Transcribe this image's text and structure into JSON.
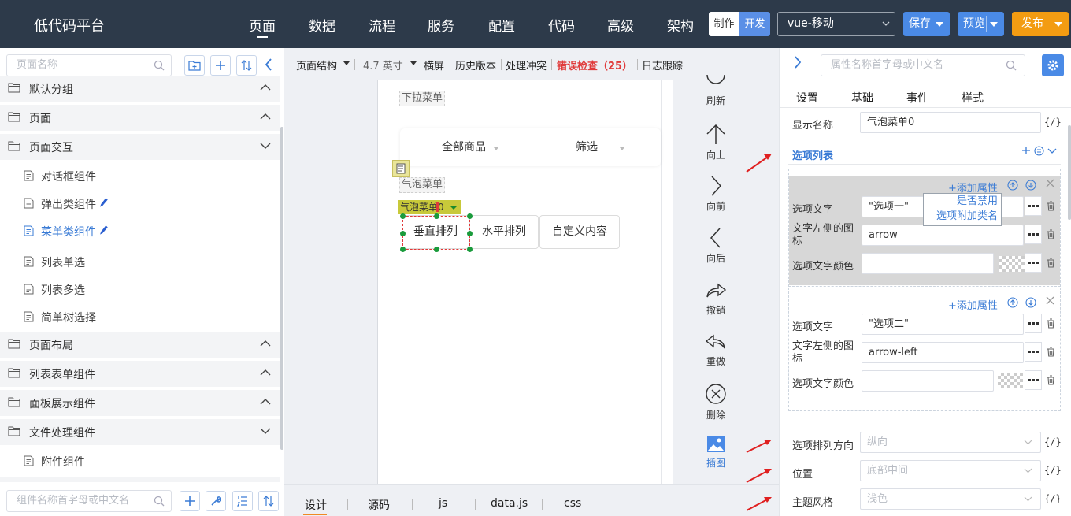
{
  "app": {
    "title": "低代码平台"
  },
  "nav": [
    "页面",
    "数据",
    "流程",
    "服务",
    "配置",
    "代码",
    "高级",
    "架构"
  ],
  "mode": {
    "a": "制作",
    "b": "开发"
  },
  "frame_select": "vue-移动",
  "buttons": {
    "save": "保存",
    "preview": "预览",
    "publish": "发布"
  },
  "colors": {
    "topbar": "#2d3a4a",
    "accent": "#3a7bd5",
    "publish": "#f39c12",
    "error": "#e03a3a"
  },
  "left": {
    "search_placeholder": "页面名称",
    "groups": [
      {
        "label": "默认分组"
      },
      {
        "label": "页面"
      },
      {
        "label": "页面交互"
      },
      {
        "label": "页面布局"
      },
      {
        "label": "列表表单组件"
      },
      {
        "label": "面板展示组件"
      },
      {
        "label": "文件处理组件"
      }
    ],
    "items": [
      "对话框组件",
      "弹出类组件",
      "菜单类组件",
      "列表单选",
      "列表多选",
      "简单树选择",
      "附件组件"
    ],
    "component_search_placeholder": "组件名称首字母或中文名"
  },
  "toolbar": {
    "structure": "页面结构",
    "size": "4.7 英寸",
    "landscape": "横屏",
    "history": "历史版本",
    "conflict": "处理冲突",
    "errors": "错误检查（25）",
    "log": "日志跟踪"
  },
  "canvas": {
    "dropdown_label": "下拉菜单",
    "dropdown_items": [
      "全部商品",
      "筛选"
    ],
    "bubble_label": "气泡菜单",
    "comp_tag": "气泡菜单0",
    "bubble_buttons": [
      "垂直排列",
      "水平排列",
      "自定义内容"
    ]
  },
  "tools": [
    "刷新",
    "向上",
    "向前",
    "向后",
    "撤销",
    "重做",
    "删除",
    "插图"
  ],
  "bottom_tabs": [
    "设计",
    "源码",
    "js",
    "data.js",
    "css"
  ],
  "right": {
    "search_placeholder": "属性名称首字母或中文名",
    "tabs": [
      "设置",
      "基础",
      "事件",
      "样式"
    ],
    "display_name_label": "显示名称",
    "display_name_value": "气泡菜单0",
    "fx": "{/}",
    "section_title": "选项列表",
    "add_attr": "+添加属性",
    "opt_text_label": "选项文字",
    "opt_icon_label": "文字左侧的图标",
    "opt_color_label": "选项文字颜色",
    "options": [
      {
        "text": "\"选项一\"",
        "icon": "arrow"
      },
      {
        "text": "\"选项二\"",
        "icon": "arrow-left"
      }
    ],
    "popup": [
      "是否禁用",
      "选项附加类名"
    ],
    "direction_label": "选项排列方向",
    "direction_value": "纵向",
    "position_label": "位置",
    "position_value": "底部中间",
    "theme_label": "主题风格",
    "theme_value": "浅色"
  }
}
